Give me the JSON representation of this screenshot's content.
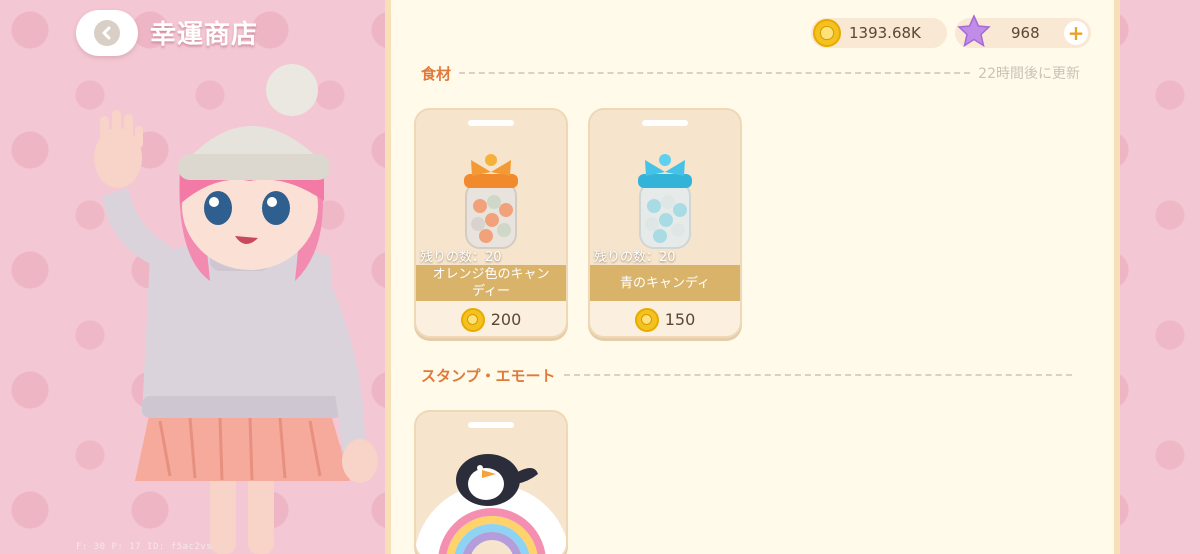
{
  "header": {
    "title": "幸運商店",
    "back_icon": "chevron-left-icon"
  },
  "debug": {
    "text": "F: 30    P: 17    ID: f5ac2vs"
  },
  "currency": {
    "coins": "1393.68K",
    "stars": "968",
    "add_label": "+"
  },
  "sections": {
    "food": {
      "title": "食材",
      "refresh_note": "22時間後に更新"
    },
    "stamps": {
      "title": "スタンプ・エモート"
    }
  },
  "items": [
    {
      "remaining": "残りの数：20",
      "name": "オレンジ色のキャンディー",
      "price": "200",
      "icon": "orange-candy-jar-icon"
    },
    {
      "remaining": "残りの数：20",
      "name": "青のキャンディ",
      "price": "150",
      "icon": "blue-candy-jar-icon"
    }
  ],
  "stickers": [
    {
      "icon": "penguin-rainbow-sticker-icon"
    }
  ],
  "colors": {
    "accent": "#e07a3b",
    "panel": "#fffaea",
    "band": "#d9b36a",
    "background": "#f3c7d3"
  }
}
